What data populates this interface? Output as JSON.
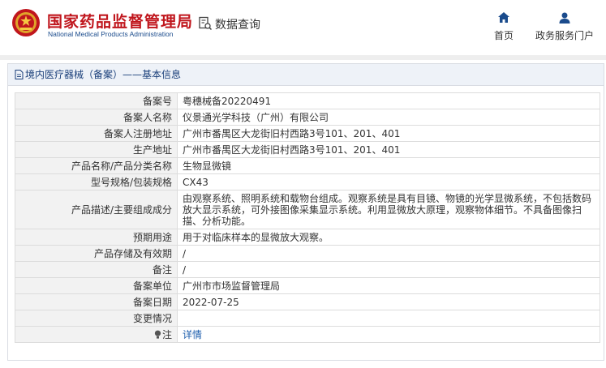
{
  "header": {
    "site_title": "国家药品监督管理局",
    "site_subtitle": "National Medical Products Administration",
    "query_label": "数据查询",
    "nav": [
      {
        "label": "首页",
        "icon": "home-icon"
      },
      {
        "label": "政务服务门户",
        "icon": "user-icon"
      }
    ]
  },
  "panel": {
    "breadcrumb": "境内医疗器械（备案）——基本信息"
  },
  "record": [
    {
      "label": "备案号",
      "value": "粤穗械备20220491"
    },
    {
      "label": "备案人名称",
      "value": "仪景通光学科技（广州）有限公司"
    },
    {
      "label": "备案人注册地址",
      "value": "广州市番禺区大龙街旧村西路3号101、201、401"
    },
    {
      "label": "生产地址",
      "value": "广州市番禺区大龙街旧村西路3号101、201、401"
    },
    {
      "label": "产品名称/产品分类名称",
      "value": "生物显微镜"
    },
    {
      "label": "型号规格/包装规格",
      "value": "CX43"
    },
    {
      "label": "产品描述/主要组成成分",
      "value": "由观察系统、照明系统和载物台组成。观察系统是具有目镜、物镜的光学显微系统，不包括数码放大显示系统，可外接图像采集显示系统。利用显微放大原理，观察物体细节。不具备图像扫描、分析功能。"
    },
    {
      "label": "预期用途",
      "value": "用于对临床样本的显微放大观察。"
    },
    {
      "label": "产品存储及有效期",
      "value": "/"
    },
    {
      "label": "备注",
      "value": "/"
    },
    {
      "label": "备案单位",
      "value": "广州市市场监督管理局"
    },
    {
      "label": "备案日期",
      "value": "2022-07-25"
    },
    {
      "label": "变更情况",
      "value": ""
    }
  ],
  "note_row": {
    "label": "注",
    "link": "详情"
  },
  "colors": {
    "brand_red": "#c0161d",
    "link_blue": "#1f5fae",
    "nav_blue": "#1a4b8c"
  }
}
